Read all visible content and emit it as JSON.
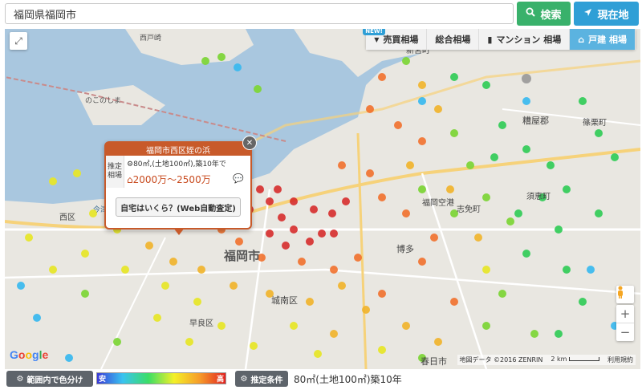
{
  "search": {
    "value": "福岡県福岡市",
    "button_label": "検索",
    "here_label": "現在地"
  },
  "tabs": [
    {
      "label": "売買相場",
      "new_badge": "NEW!"
    },
    {
      "label": "総合相場"
    },
    {
      "label": "マンション 相場"
    },
    {
      "label": "戸建 相場"
    }
  ],
  "map": {
    "labels": {
      "fukuoka_city": "福岡市",
      "nishi_ku": "西区",
      "jonan_ku": "城南区",
      "hakata": "博多",
      "kasuga": "春日市",
      "kasuya": "糟屋郡",
      "shime": "志免町",
      "sue": "須恵町",
      "sasaguri": "篠栗町",
      "shingu": "新宮町",
      "sawara": "早良区",
      "airport": "福岡空港",
      "imajuku": "今津湾",
      "nokonoshima": "のこのしま",
      "shikanoshima": "西戸崎"
    },
    "google": [
      "G",
      "o",
      "o",
      "g",
      "l",
      "e"
    ],
    "attribution": "地図データ ©2016 ZENRIN",
    "scale": "2 km",
    "terms": "利用規約"
  },
  "popup": {
    "title": "福岡市西区姪の浜",
    "label": "推定相場",
    "condition": "80㎡,(土地100㎡),築10年で",
    "price": "2000万〜2500万",
    "button": "自宅はいくら？(Web自動査定)"
  },
  "bottom": {
    "colorize_label": "範囲内で色分け",
    "legend_low": "安",
    "legend_high": "高",
    "condition_button": "推定条件",
    "condition_text": "80㎡(土地100㎡)築10年"
  }
}
